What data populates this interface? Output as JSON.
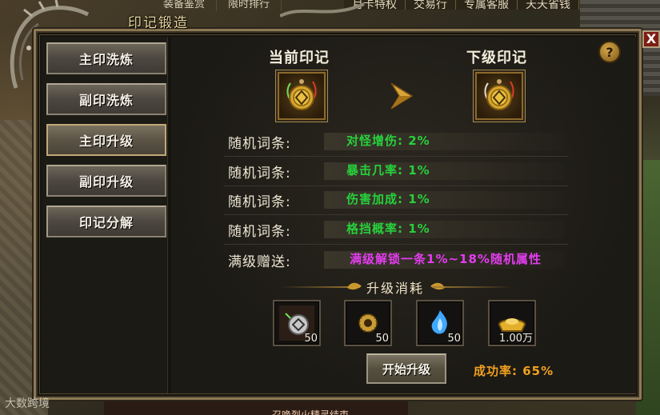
{
  "top_menu": {
    "left": [
      "装备鉴赏",
      "限时排行"
    ],
    "right": [
      "月卡特权",
      "交易行",
      "专属客服",
      "天天省钱"
    ]
  },
  "window": {
    "title": "印记锻造",
    "close_label": "X",
    "help_label": "?"
  },
  "nav": {
    "items": [
      {
        "label": "主印洗炼"
      },
      {
        "label": "副印洗炼"
      },
      {
        "label": "主印升级",
        "active": true
      },
      {
        "label": "副印升级"
      },
      {
        "label": "印记分解"
      }
    ]
  },
  "seals": {
    "current_label": "当前印记",
    "next_label": "下级印记"
  },
  "stats": {
    "rows": [
      {
        "key": "随机词条:",
        "value": "对怪增伤: 2%"
      },
      {
        "key": "随机词条:",
        "value": "暴击几率: 1%"
      },
      {
        "key": "随机词条:",
        "value": "伤害加成: 1%"
      },
      {
        "key": "随机词条:",
        "value": "格挡概率: 1%"
      }
    ],
    "bonus_key": "满级赠送:",
    "bonus_value": "满级解锁一条1%~18%随机属性"
  },
  "cost": {
    "header": "升级消耗",
    "items": [
      {
        "icon": "seal-item-icon",
        "count": "50"
      },
      {
        "icon": "gear-crystal-icon",
        "count": "50"
      },
      {
        "icon": "blue-flame-icon",
        "count": "50"
      },
      {
        "icon": "gold-ingot-icon",
        "count": "1.00万"
      }
    ]
  },
  "actions": {
    "upgrade_label": "开始升级",
    "success_rate": "成功率: 65%"
  },
  "watermark": "大数跨境",
  "bottom_text": "召唤烈火精灵结束",
  "colors": {
    "stat_green": "#27d13b",
    "bonus_pink": "#e43cf0",
    "rate_orange": "#f0a020"
  }
}
